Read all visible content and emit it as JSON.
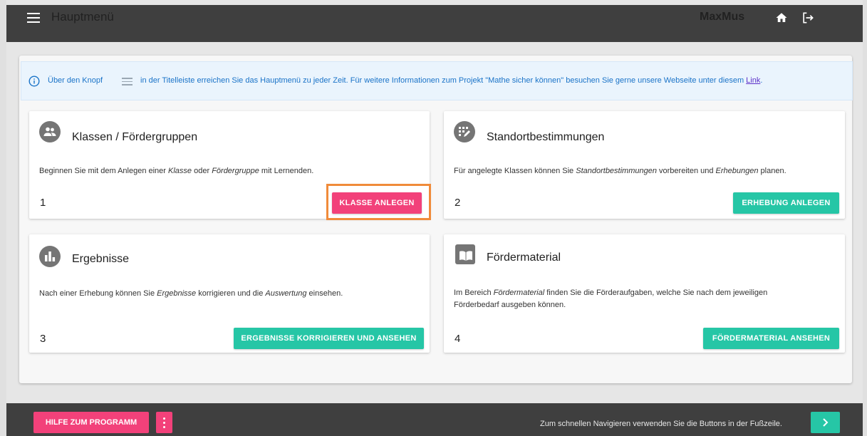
{
  "header": {
    "menu_title": "Hauptmenü",
    "user": "MaxMus"
  },
  "info": {
    "text_before": "Über den Knopf",
    "text_after": "in der Titelleiste erreichen Sie das Hauptmenü zu jeder Zeit. Für weitere Informationen zum Projekt \"Mathe sicher können\" besuchen Sie gerne unsere Webseite unter diesem ",
    "link": "Link",
    "text_end": "."
  },
  "cards": [
    {
      "title": "Klassen / Fördergruppen",
      "desc_1": "Beginnen Sie mit dem Anlegen einer ",
      "desc_em1": "Klasse",
      "desc_2": " oder ",
      "desc_em2": "Fördergruppe",
      "desc_3": " mit Lernenden.",
      "number": "1",
      "button": "KLASSE ANLEGEN",
      "icon": "group-icon"
    },
    {
      "title": "Standortbestimmungen",
      "desc_1": "Für angelegte Klassen können Sie ",
      "desc_em1": "Standortbestimmungen",
      "desc_2": " vorbereiten und ",
      "desc_em2": "Erhebungen",
      "desc_3": " planen.",
      "number": "2",
      "button": "ERHEBUNG ANLEGEN",
      "icon": "plan-grid-icon"
    },
    {
      "title": "Ergebnisse",
      "desc_1": "Nach einer Erhebung können Sie ",
      "desc_em1": "Ergebnisse",
      "desc_2": " korrigieren und die ",
      "desc_em2": "Auswertung",
      "desc_3": " einsehen.",
      "number": "3",
      "button": "ERGEBNISSE KORRIGIEREN UND ANSEHEN",
      "icon": "bar-chart-icon"
    },
    {
      "title": "Fördermaterial",
      "desc_1": "Im Bereich ",
      "desc_em1": "Fördermaterial",
      "desc_2": " finden Sie die Förderaufgaben, welche Sie nach dem jeweiligen",
      "desc_line2": "Förderbedarf ausgeben können.",
      "number": "4",
      "button": "FÖRDERMATERIAL ANSEHEN",
      "icon": "book-icon"
    }
  ],
  "footer": {
    "help_button": "HILFE ZUM PROGRAMM",
    "hint": "Zum schnellen Navigieren verwenden Sie die Buttons in der Fußzeile."
  },
  "colors": {
    "bar": "#3f3f3f",
    "teal": "#26c6a6",
    "pink": "#f2417a",
    "highlight": "#f08b3a",
    "info_text": "#1a73c8"
  }
}
